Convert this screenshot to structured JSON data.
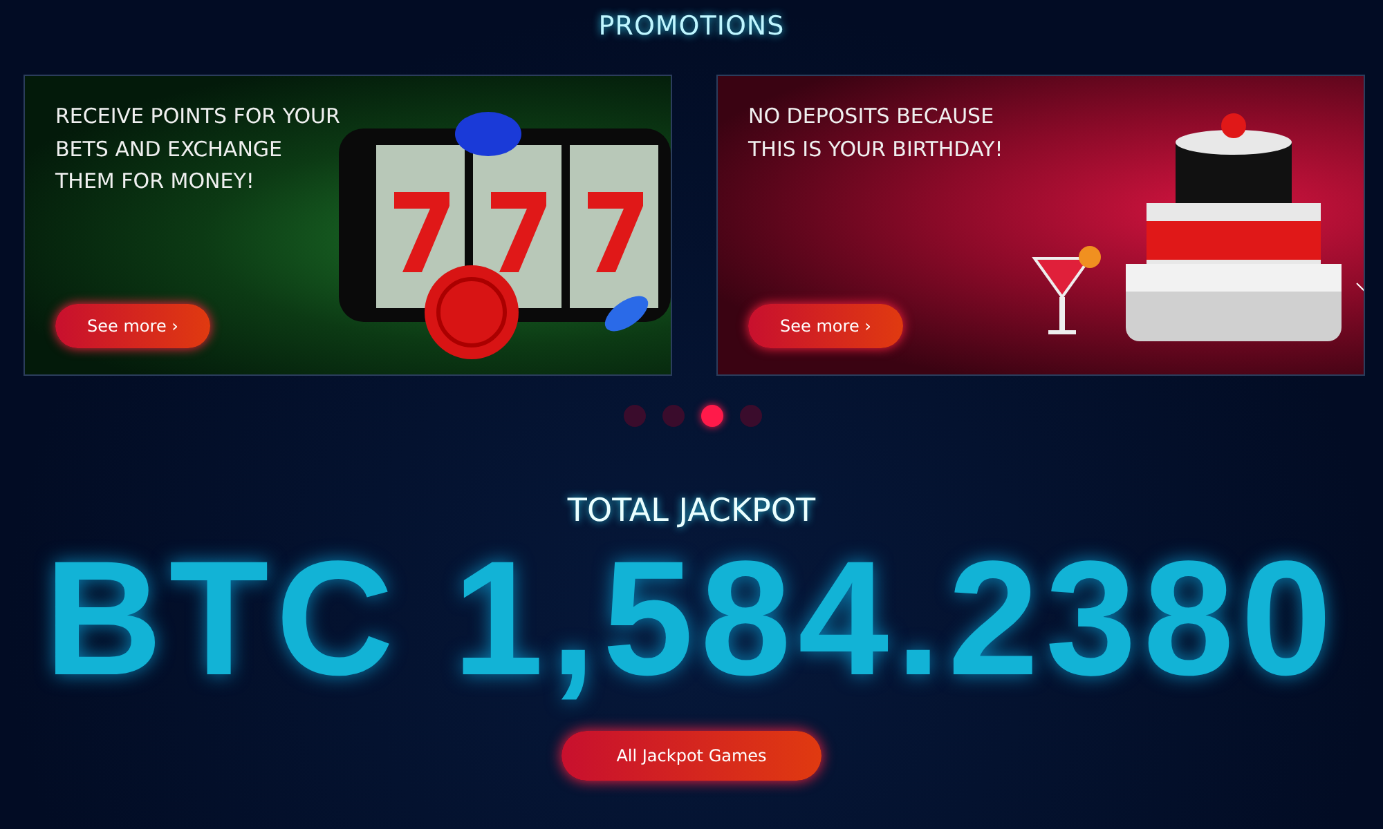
{
  "section_title": "PROMOTIONS",
  "promotions": [
    {
      "kind": "slots",
      "text": "RECEIVE POINTS FOR YOUR BETS AND EXCHANGE THEM FOR MONEY!",
      "button": "See more ›"
    },
    {
      "kind": "birthday",
      "text": "NO DEPOSITS BECAUSE THIS IS YOUR BIRTHDAY!",
      "button": "See more ›"
    }
  ],
  "carousel_dots": [
    {
      "selected": false
    },
    {
      "selected": false
    },
    {
      "selected": true
    },
    {
      "selected": false
    }
  ],
  "jackpot": {
    "title": "TOTAL JACKPOT",
    "amount": "BTC 1,584.2380",
    "button": "All Jackpot Games"
  }
}
